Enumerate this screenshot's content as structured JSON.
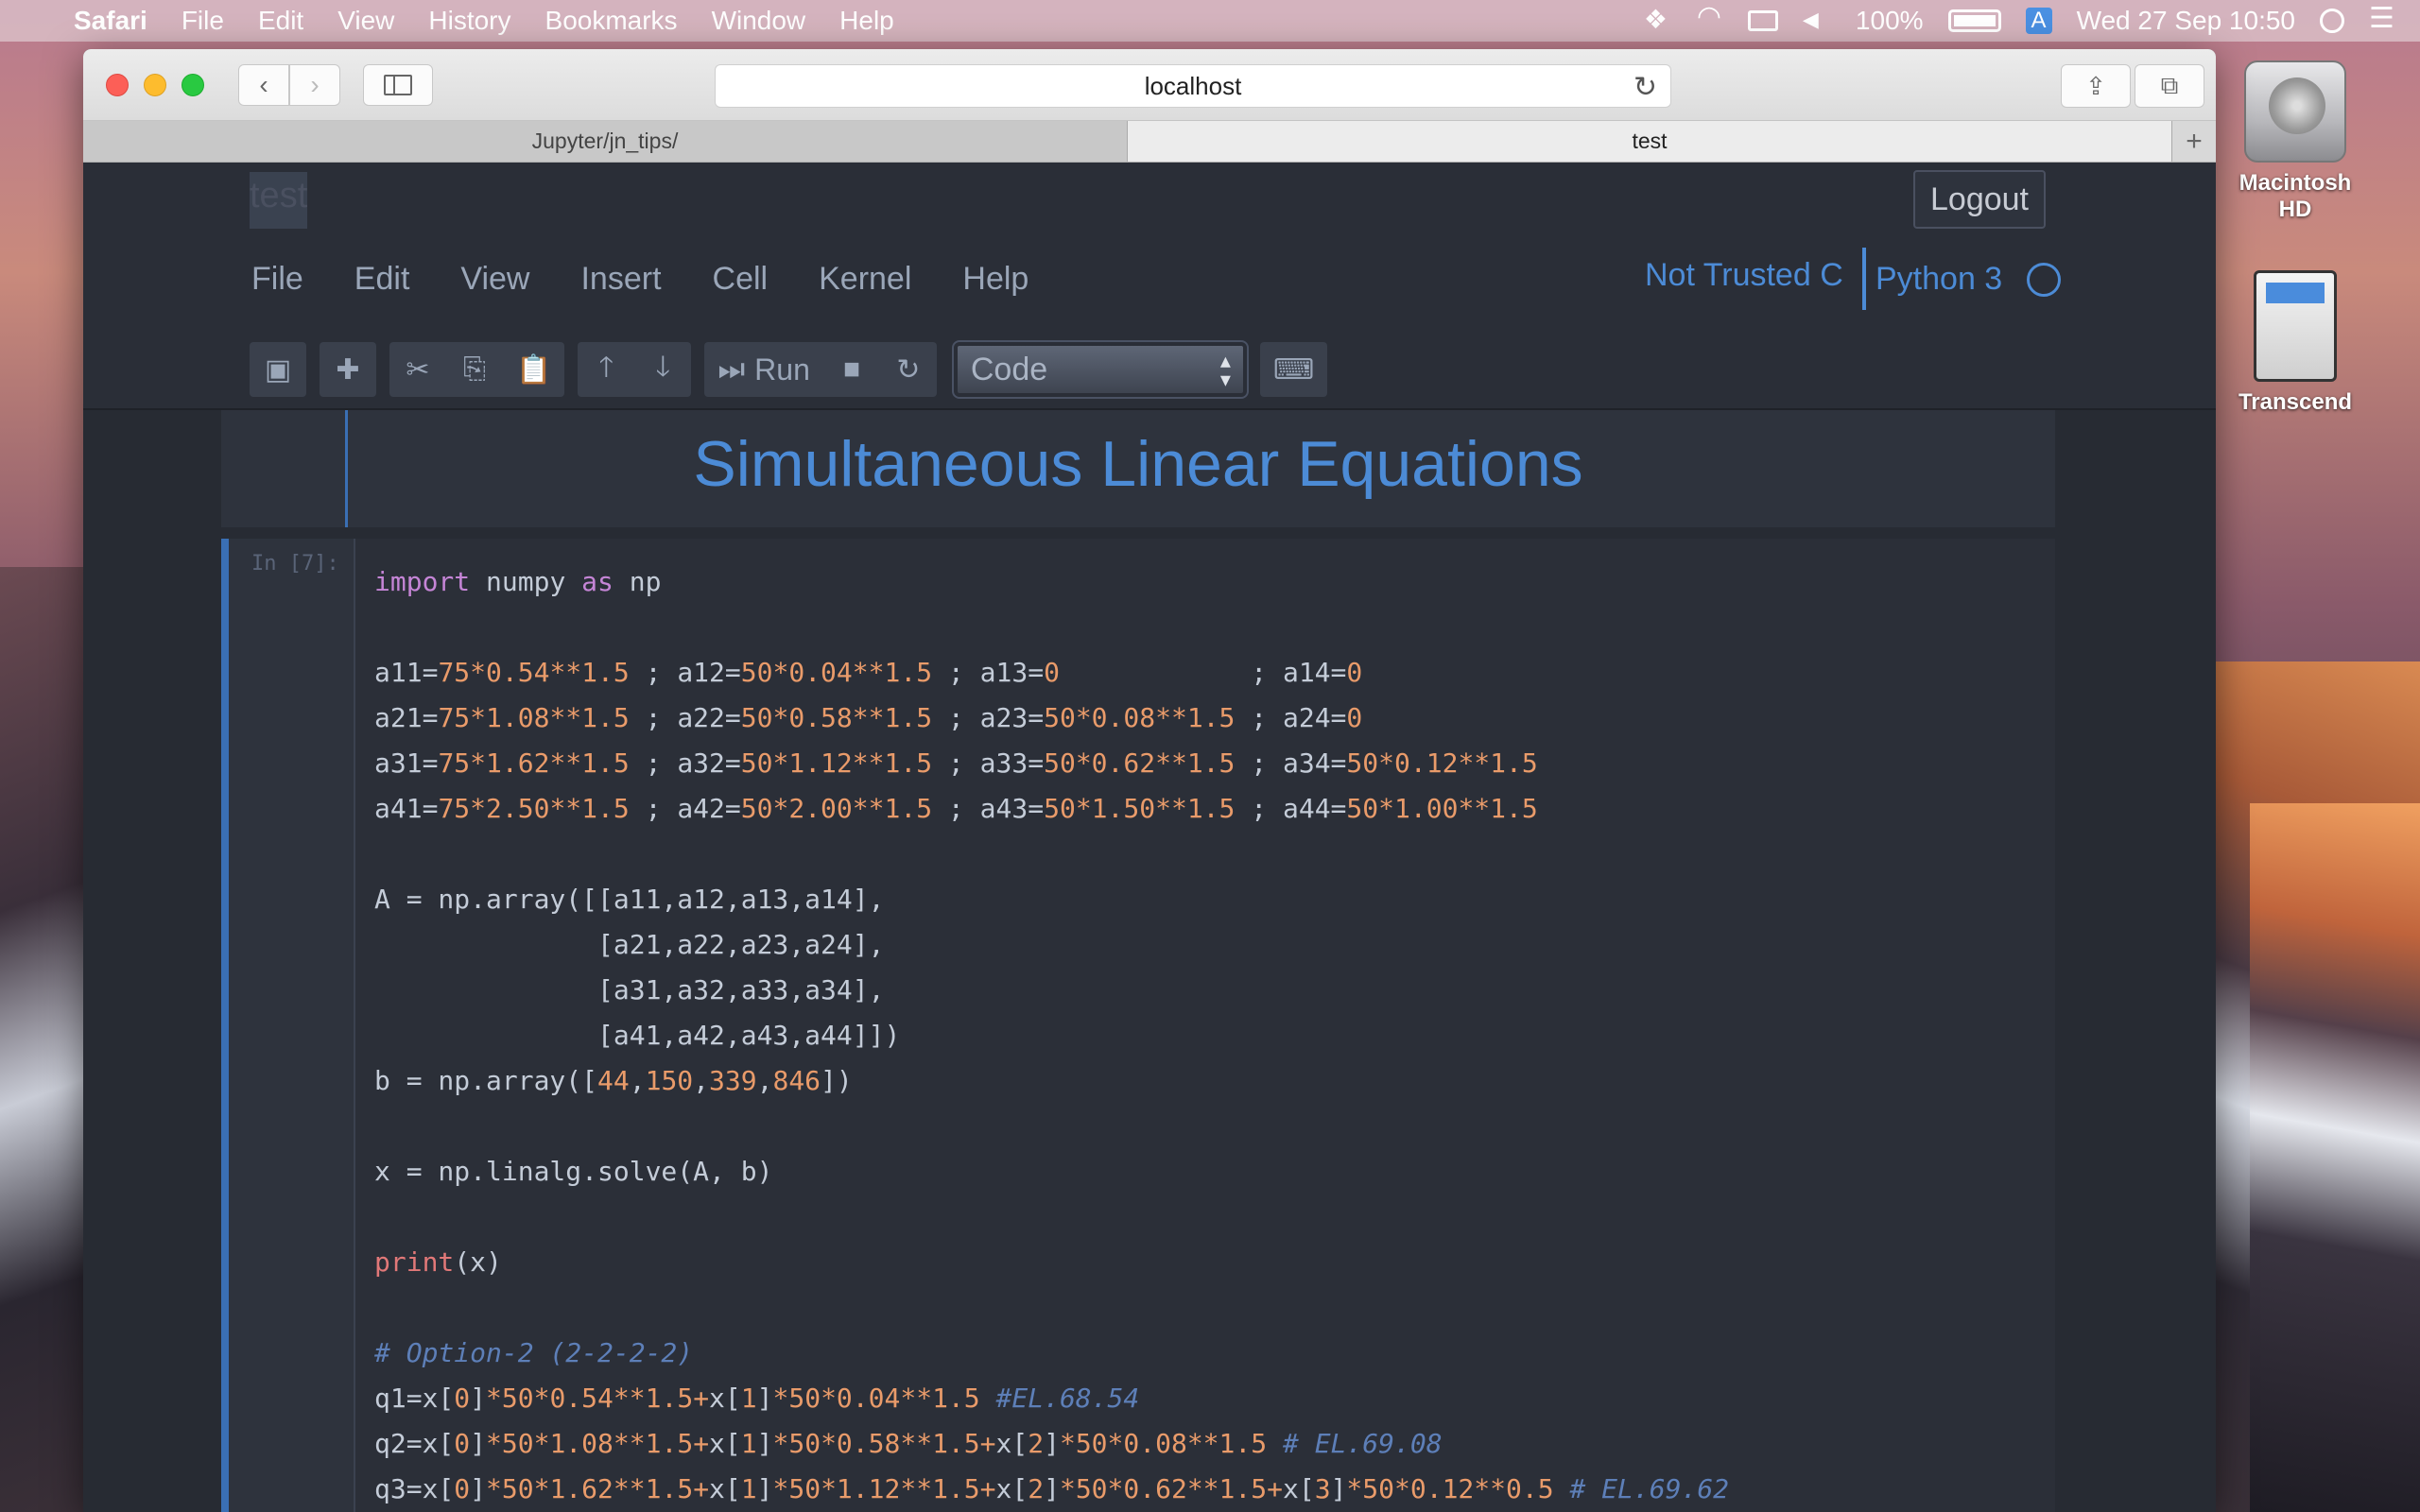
{
  "menubar": {
    "app": "Safari",
    "items": [
      "File",
      "Edit",
      "View",
      "History",
      "Bookmarks",
      "Window",
      "Help"
    ],
    "battery": "100%",
    "input_source": "A",
    "datetime": "Wed 27 Sep  10:50"
  },
  "desktop": {
    "icons": [
      {
        "label": "Macintosh HD",
        "icon": "hard-drive-icon"
      },
      {
        "label": "Transcend",
        "icon": "sd-card-icon"
      }
    ]
  },
  "browser": {
    "url": "localhost",
    "tabs": [
      {
        "label": "Jupyter/jn_tips/",
        "active": false
      },
      {
        "label": "test",
        "active": true
      }
    ]
  },
  "jupyter": {
    "notebook_name": "test",
    "logout_label": "Logout",
    "menu": [
      "File",
      "Edit",
      "View",
      "Insert",
      "Cell",
      "Kernel",
      "Help"
    ],
    "trust_label": "Not Trusted",
    "trust_icon": "C",
    "kernel_label": "Python 3",
    "toolbar": {
      "run_label": "Run",
      "cell_type": "Code"
    }
  },
  "notebook": {
    "markdown_title": "Simultaneous Linear Equations",
    "code_prompt": "In [7]:",
    "code_lines": [
      "import numpy as np",
      "",
      "a11=75*0.54**1.5 ; a12=50*0.04**1.5 ; a13=0            ; a14=0",
      "a21=75*1.08**1.5 ; a22=50*0.58**1.5 ; a23=50*0.08**1.5 ; a24=0",
      "a31=75*1.62**1.5 ; a32=50*1.12**1.5 ; a33=50*0.62**1.5 ; a34=50*0.12**1.5",
      "a41=75*2.50**1.5 ; a42=50*2.00**1.5 ; a43=50*1.50**1.5 ; a44=50*1.00**1.5",
      "",
      "A = np.array([[a11,a12,a13,a14],",
      "              [a21,a22,a23,a24],",
      "              [a31,a32,a33,a34],",
      "              [a41,a42,a43,a44]])",
      "b = np.array([44,150,339,846])",
      "",
      "x = np.linalg.solve(A, b)",
      "",
      "print(x)",
      "",
      "# Option-2 (2-2-2-2)",
      "q1=x[0]*50*0.54**1.5+x[1]*50*0.04**1.5 #EL.68.54",
      "q2=x[0]*50*1.08**1.5+x[1]*50*0.58**1.5+x[2]*50*0.08**1.5 # EL.69.08",
      "q3=x[0]*50*1.62**1.5+x[1]*50*1.12**1.5+x[2]*50*0.62**1.5+x[3]*50*0.12**0.5 # EL.69.62"
    ]
  }
}
